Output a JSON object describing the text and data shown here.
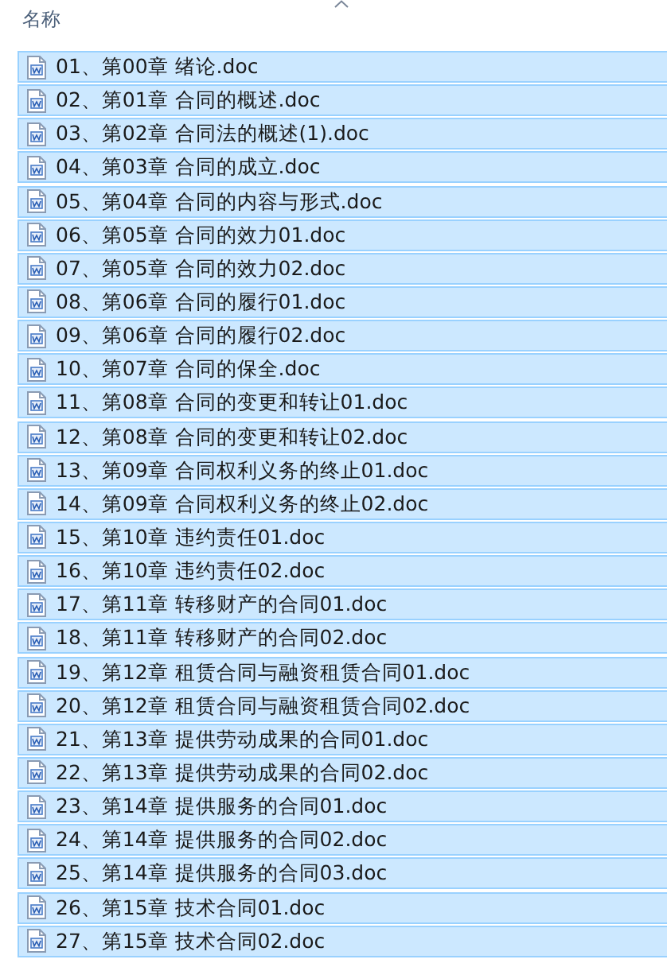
{
  "header": {
    "label": "名称",
    "sort_ascending": true
  },
  "files": [
    {
      "name": "01、第00章 绪论.doc",
      "selected": true
    },
    {
      "name": "02、第01章 合同的概述.doc",
      "selected": true
    },
    {
      "name": "03、第02章 合同法的概述(1).doc",
      "selected": true
    },
    {
      "name": "04、第03章 合同的成立.doc",
      "selected": true
    },
    {
      "name": "05、第04章 合同的内容与形式.doc",
      "selected": true
    },
    {
      "name": "06、第05章 合同的效力01.doc",
      "selected": true
    },
    {
      "name": "07、第05章 合同的效力02.doc",
      "selected": true
    },
    {
      "name": "08、第06章 合同的履行01.doc",
      "selected": true
    },
    {
      "name": "09、第06章 合同的履行02.doc",
      "selected": true
    },
    {
      "name": "10、第07章 合同的保全.doc",
      "selected": true
    },
    {
      "name": "11、第08章 合同的变更和转让01.doc",
      "selected": true
    },
    {
      "name": "12、第08章 合同的变更和转让02.doc",
      "selected": true
    },
    {
      "name": "13、第09章 合同权利义务的终止01.doc",
      "selected": true
    },
    {
      "name": "14、第09章 合同权利义务的终止02.doc",
      "selected": true
    },
    {
      "name": "15、第10章 违约责任01.doc",
      "selected": true
    },
    {
      "name": "16、第10章 违约责任02.doc",
      "selected": true
    },
    {
      "name": "17、第11章 转移财产的合同01.doc",
      "selected": true
    },
    {
      "name": "18、第11章 转移财产的合同02.doc",
      "selected": true
    },
    {
      "name": "19、第12章 租赁合同与融资租赁合同01.doc",
      "selected": true
    },
    {
      "name": "20、第12章 租赁合同与融资租赁合同02.doc",
      "selected": true
    },
    {
      "name": "21、第13章 提供劳动成果的合同01.doc",
      "selected": true
    },
    {
      "name": "22、第13章 提供劳动成果的合同02.doc",
      "selected": true
    },
    {
      "name": "23、第14章 提供服务的合同01.doc",
      "selected": true
    },
    {
      "name": "24、第14章 提供服务的合同02.doc",
      "selected": true
    },
    {
      "name": "25、第14章 提供服务的合同03.doc",
      "selected": true
    },
    {
      "name": "26、第15章 技术合同01.doc",
      "selected": true
    },
    {
      "name": "27、第15章 技术合同02.doc",
      "selected": true
    }
  ]
}
